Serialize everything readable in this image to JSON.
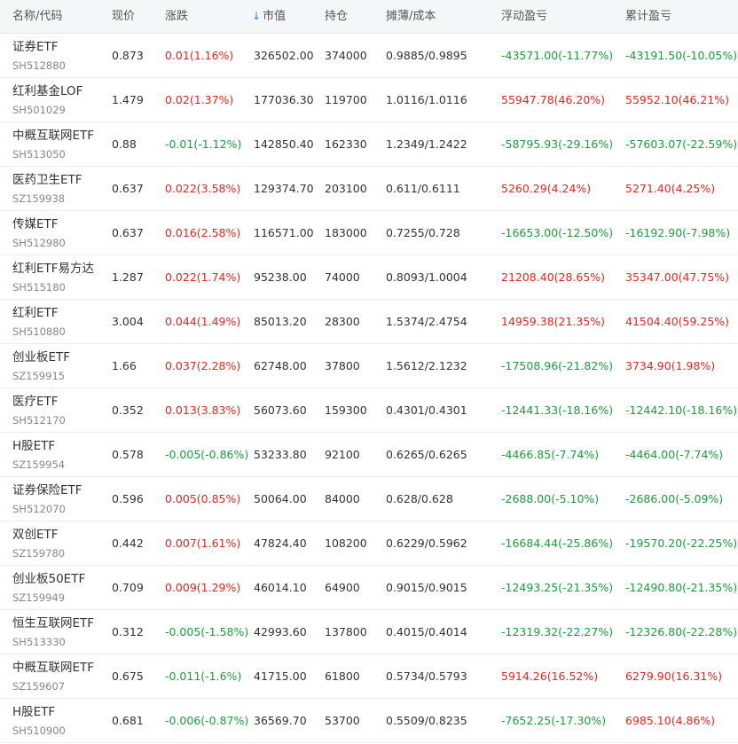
{
  "colors": {
    "up": "#e0271e",
    "down": "#1a9e3a",
    "header_bg": "#f5f6f8",
    "sort_icon": "#3a7bd5"
  },
  "header": {
    "name_code": "名称/代码",
    "price": "现价",
    "change": "涨跌",
    "sort_icon": "↓",
    "market_value": "市值",
    "position": "持仓",
    "cost": "摊薄/成本",
    "float_pl": "浮动盈亏",
    "cum_pl": "累计盈亏"
  },
  "rows": [
    {
      "name": "证券ETF",
      "code": "SH512880",
      "price": "0.873",
      "change": "0.01(1.16%)",
      "change_dir": "up",
      "market_value": "326502.00",
      "position": "374000",
      "cost": "0.9885/0.9895",
      "float_pl": "-43571.00(-11.77%)",
      "float_dir": "down",
      "cum_pl": "-43191.50(-10.05%)",
      "cum_dir": "down"
    },
    {
      "name": "红利基金LOF",
      "code": "SH501029",
      "price": "1.479",
      "change": "0.02(1.37%)",
      "change_dir": "up",
      "market_value": "177036.30",
      "position": "119700",
      "cost": "1.0116/1.0116",
      "float_pl": "55947.78(46.20%)",
      "float_dir": "up",
      "cum_pl": "55952.10(46.21%)",
      "cum_dir": "up"
    },
    {
      "name": "中概互联网ETF",
      "code": "SH513050",
      "price": "0.88",
      "change": "-0.01(-1.12%)",
      "change_dir": "down",
      "market_value": "142850.40",
      "position": "162330",
      "cost": "1.2349/1.2422",
      "float_pl": "-58795.93(-29.16%)",
      "float_dir": "down",
      "cum_pl": "-57603.07(-22.59%)",
      "cum_dir": "down"
    },
    {
      "name": "医药卫生ETF",
      "code": "SZ159938",
      "price": "0.637",
      "change": "0.022(3.58%)",
      "change_dir": "up",
      "market_value": "129374.70",
      "position": "203100",
      "cost": "0.611/0.6111",
      "float_pl": "5260.29(4.24%)",
      "float_dir": "up",
      "cum_pl": "5271.40(4.25%)",
      "cum_dir": "up"
    },
    {
      "name": "传媒ETF",
      "code": "SH512980",
      "price": "0.637",
      "change": "0.016(2.58%)",
      "change_dir": "up",
      "market_value": "116571.00",
      "position": "183000",
      "cost": "0.7255/0.728",
      "float_pl": "-16653.00(-12.50%)",
      "float_dir": "down",
      "cum_pl": "-16192.90(-7.98%)",
      "cum_dir": "down"
    },
    {
      "name": "红利ETF易方达",
      "code": "SH515180",
      "price": "1.287",
      "change": "0.022(1.74%)",
      "change_dir": "up",
      "market_value": "95238.00",
      "position": "74000",
      "cost": "0.8093/1.0004",
      "float_pl": "21208.40(28.65%)",
      "float_dir": "up",
      "cum_pl": "35347.00(47.75%)",
      "cum_dir": "up"
    },
    {
      "name": "红利ETF",
      "code": "SH510880",
      "price": "3.004",
      "change": "0.044(1.49%)",
      "change_dir": "up",
      "market_value": "85013.20",
      "position": "28300",
      "cost": "1.5374/2.4754",
      "float_pl": "14959.38(21.35%)",
      "float_dir": "up",
      "cum_pl": "41504.40(59.25%)",
      "cum_dir": "up"
    },
    {
      "name": "创业板ETF",
      "code": "SZ159915",
      "price": "1.66",
      "change": "0.037(2.28%)",
      "change_dir": "up",
      "market_value": "62748.00",
      "position": "37800",
      "cost": "1.5612/2.1232",
      "float_pl": "-17508.96(-21.82%)",
      "float_dir": "down",
      "cum_pl": "3734.90(1.98%)",
      "cum_dir": "up"
    },
    {
      "name": "医疗ETF",
      "code": "SH512170",
      "price": "0.352",
      "change": "0.013(3.83%)",
      "change_dir": "up",
      "market_value": "56073.60",
      "position": "159300",
      "cost": "0.4301/0.4301",
      "float_pl": "-12441.33(-18.16%)",
      "float_dir": "down",
      "cum_pl": "-12442.10(-18.16%)",
      "cum_dir": "down"
    },
    {
      "name": "H股ETF",
      "code": "SZ159954",
      "price": "0.578",
      "change": "-0.005(-0.86%)",
      "change_dir": "down",
      "market_value": "53233.80",
      "position": "92100",
      "cost": "0.6265/0.6265",
      "float_pl": "-4466.85(-7.74%)",
      "float_dir": "down",
      "cum_pl": "-4464.00(-7.74%)",
      "cum_dir": "down"
    },
    {
      "name": "证券保险ETF",
      "code": "SH512070",
      "price": "0.596",
      "change": "0.005(0.85%)",
      "change_dir": "up",
      "market_value": "50064.00",
      "position": "84000",
      "cost": "0.628/0.628",
      "float_pl": "-2688.00(-5.10%)",
      "float_dir": "down",
      "cum_pl": "-2686.00(-5.09%)",
      "cum_dir": "down"
    },
    {
      "name": "双创ETF",
      "code": "SZ159780",
      "price": "0.442",
      "change": "0.007(1.61%)",
      "change_dir": "up",
      "market_value": "47824.40",
      "position": "108200",
      "cost": "0.6229/0.5962",
      "float_pl": "-16684.44(-25.86%)",
      "float_dir": "down",
      "cum_pl": "-19570.20(-22.25%)",
      "cum_dir": "down"
    },
    {
      "name": "创业板50ETF",
      "code": "SZ159949",
      "price": "0.709",
      "change": "0.009(1.29%)",
      "change_dir": "up",
      "market_value": "46014.10",
      "position": "64900",
      "cost": "0.9015/0.9015",
      "float_pl": "-12493.25(-21.35%)",
      "float_dir": "down",
      "cum_pl": "-12490.80(-21.35%)",
      "cum_dir": "down"
    },
    {
      "name": "恒生互联网ETF",
      "code": "SH513330",
      "price": "0.312",
      "change": "-0.005(-1.58%)",
      "change_dir": "down",
      "market_value": "42993.60",
      "position": "137800",
      "cost": "0.4015/0.4014",
      "float_pl": "-12319.32(-22.27%)",
      "float_dir": "down",
      "cum_pl": "-12326.80(-22.28%)",
      "cum_dir": "down"
    },
    {
      "name": "中概互联网ETF",
      "code": "SZ159607",
      "price": "0.675",
      "change": "-0.011(-1.6%)",
      "change_dir": "down",
      "market_value": "41715.00",
      "position": "61800",
      "cost": "0.5734/0.5793",
      "float_pl": "5914.26(16.52%)",
      "float_dir": "up",
      "cum_pl": "6279.90(16.31%)",
      "cum_dir": "up"
    },
    {
      "name": "H股ETF",
      "code": "SH510900",
      "price": "0.681",
      "change": "-0.006(-0.87%)",
      "change_dir": "down",
      "market_value": "36569.70",
      "position": "53700",
      "cost": "0.5509/0.8235",
      "float_pl": "-7652.25(-17.30%)",
      "float_dir": "down",
      "cum_pl": "6985.10(4.86%)",
      "cum_dir": "up"
    }
  ]
}
